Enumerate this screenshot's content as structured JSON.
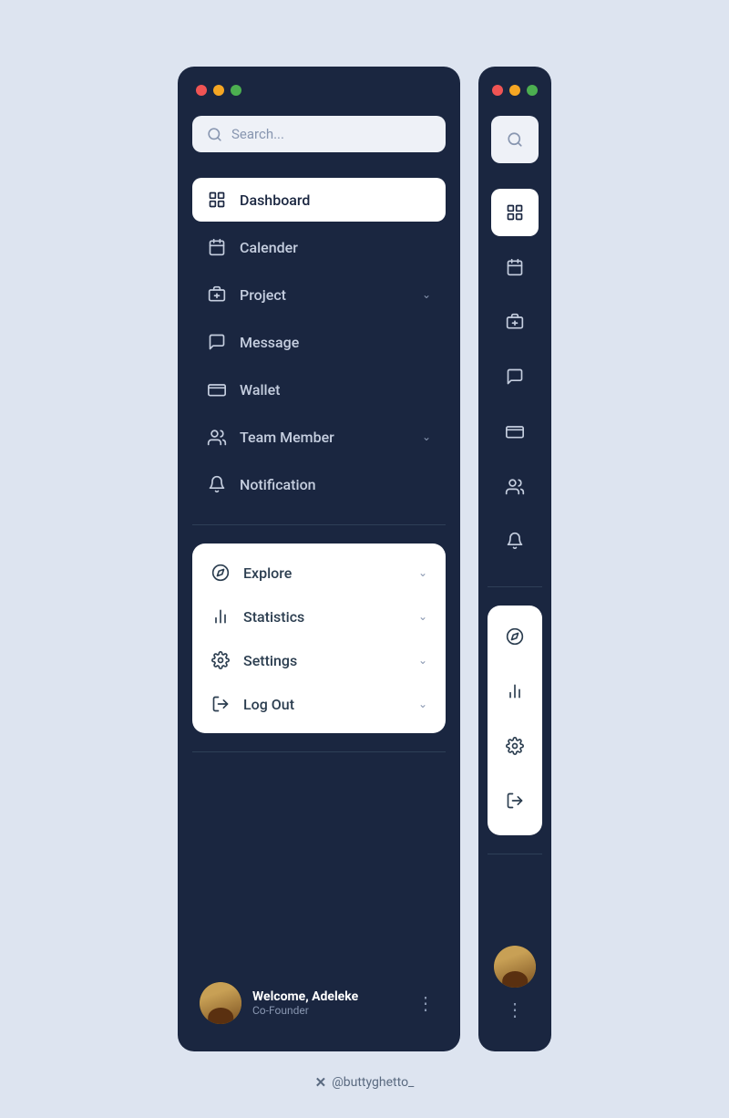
{
  "colors": {
    "bg": "#dde4f0",
    "sidebar_dark": "#1a2640",
    "sidebar_light_card": "#ffffff",
    "search_bg": "#eef1f7",
    "text_primary": "#c5cedf",
    "text_dark": "#2c3e50",
    "divider": "#2e3f57"
  },
  "expanded_sidebar": {
    "search_placeholder": "Search...",
    "nav_items": [
      {
        "id": "dashboard",
        "label": "Dashboard",
        "active": true,
        "has_chevron": false
      },
      {
        "id": "calendar",
        "label": "Calender",
        "active": false,
        "has_chevron": false
      },
      {
        "id": "project",
        "label": "Project",
        "active": false,
        "has_chevron": true
      },
      {
        "id": "message",
        "label": "Message",
        "active": false,
        "has_chevron": false
      },
      {
        "id": "wallet",
        "label": "Wallet",
        "active": false,
        "has_chevron": false
      },
      {
        "id": "team-member",
        "label": "Team Member",
        "active": false,
        "has_chevron": true
      },
      {
        "id": "notification",
        "label": "Notification",
        "active": false,
        "has_chevron": false
      }
    ],
    "secondary_items": [
      {
        "id": "explore",
        "label": "Explore",
        "has_chevron": true
      },
      {
        "id": "statistics",
        "label": "Statistics",
        "has_chevron": true
      },
      {
        "id": "settings",
        "label": "Settings",
        "has_chevron": true
      },
      {
        "id": "logout",
        "label": "Log Out",
        "has_chevron": true
      }
    ],
    "user": {
      "name": "Welcome, Adeleke",
      "role": "Co-Founder"
    }
  },
  "collapsed_sidebar": {
    "nav_items": [
      "dashboard",
      "calendar",
      "project",
      "message",
      "wallet",
      "team-member",
      "notification"
    ],
    "secondary_items": [
      "explore",
      "statistics",
      "settings",
      "logout"
    ]
  },
  "attribution": {
    "icon": "✕",
    "handle": "@buttyghetto_"
  }
}
